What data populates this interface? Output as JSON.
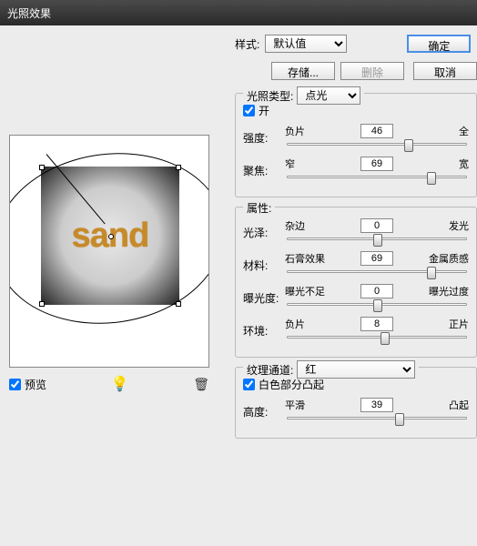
{
  "title": "光照效果",
  "top": {
    "style_label": "样式:",
    "style_value": "默认值",
    "save": "存储...",
    "delete": "删除",
    "ok": "确定",
    "cancel": "取消"
  },
  "preview": {
    "sample_text": "sand",
    "checkbox_label": "预览"
  },
  "light": {
    "legend": "光照类型:",
    "type_value": "点光",
    "on_label": "开",
    "intensity": {
      "label": "强度:",
      "left": "负片",
      "right": "全",
      "value": "46",
      "pos": 65
    },
    "focus": {
      "label": "聚焦:",
      "left": "窄",
      "right": "宽",
      "value": "69",
      "pos": 78
    }
  },
  "props": {
    "legend": "属性:",
    "gloss": {
      "label": "光泽:",
      "left": "杂边",
      "right": "发光",
      "value": "0",
      "pos": 48
    },
    "material": {
      "label": "材料:",
      "left": "石膏效果",
      "right": "金属质感",
      "value": "69",
      "pos": 78
    },
    "exposure": {
      "label": "曝光度:",
      "left": "曝光不足",
      "right": "曝光过度",
      "value": "0",
      "pos": 48
    },
    "ambience": {
      "label": "环境:",
      "left": "负片",
      "right": "正片",
      "value": "8",
      "pos": 52
    }
  },
  "texture": {
    "legend": "纹理通道:",
    "channel_value": "红",
    "white_high_label": "白色部分凸起",
    "height": {
      "label": "高度:",
      "left": "平滑",
      "right": "凸起",
      "value": "39",
      "pos": 60
    }
  }
}
